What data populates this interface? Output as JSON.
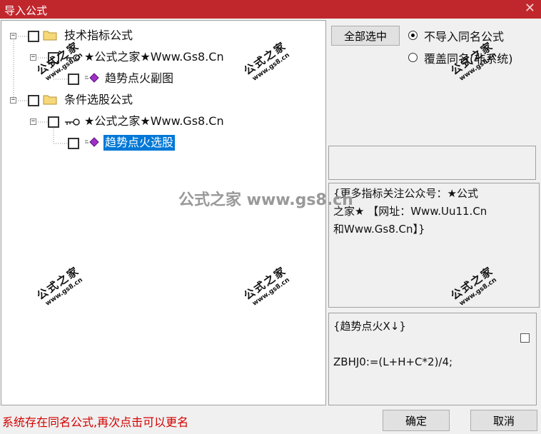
{
  "window": {
    "title": "导入公式",
    "close_glyph": "✕"
  },
  "tree": [
    {
      "label": "技术指标公式",
      "type": "folder"
    },
    {
      "label": "★公式之家★Www.Gs8.Cn",
      "type": "key"
    },
    {
      "label": "趋势点火副图",
      "type": "formula"
    },
    {
      "label": "条件选股公式",
      "type": "folder"
    },
    {
      "label": "★公式之家★Www.Gs8.Cn",
      "type": "key"
    },
    {
      "label": "趋势点火选股",
      "type": "formula",
      "selected": true
    }
  ],
  "buttons": {
    "select_all": "全部选中",
    "ok": "确定",
    "cancel": "取消"
  },
  "options": {
    "no_import_same": "不导入同名公式",
    "overwrite_same": "覆盖同名(非系统)",
    "selected": "no_import_same"
  },
  "description": {
    "line1": "{更多指标关注公众号：★公式",
    "line2": "之家★ 【网址：Www.Uu11.Cn",
    "line3": "和Www.Gs8.Cn】}"
  },
  "code": {
    "line1": "{趋势点火X↓}",
    "line2": "ZBHJ0:=(L+H+C*2)/4;"
  },
  "status": "系统存在同名公式,再次点击可以更名",
  "watermark": {
    "text": "公式之家",
    "url": "www.gs8.cn",
    "center": "公式之家 www.gs8.cn"
  },
  "colors": {
    "title_bar": "#c0272d",
    "selection": "#0078d7",
    "status_text": "#d40000"
  }
}
